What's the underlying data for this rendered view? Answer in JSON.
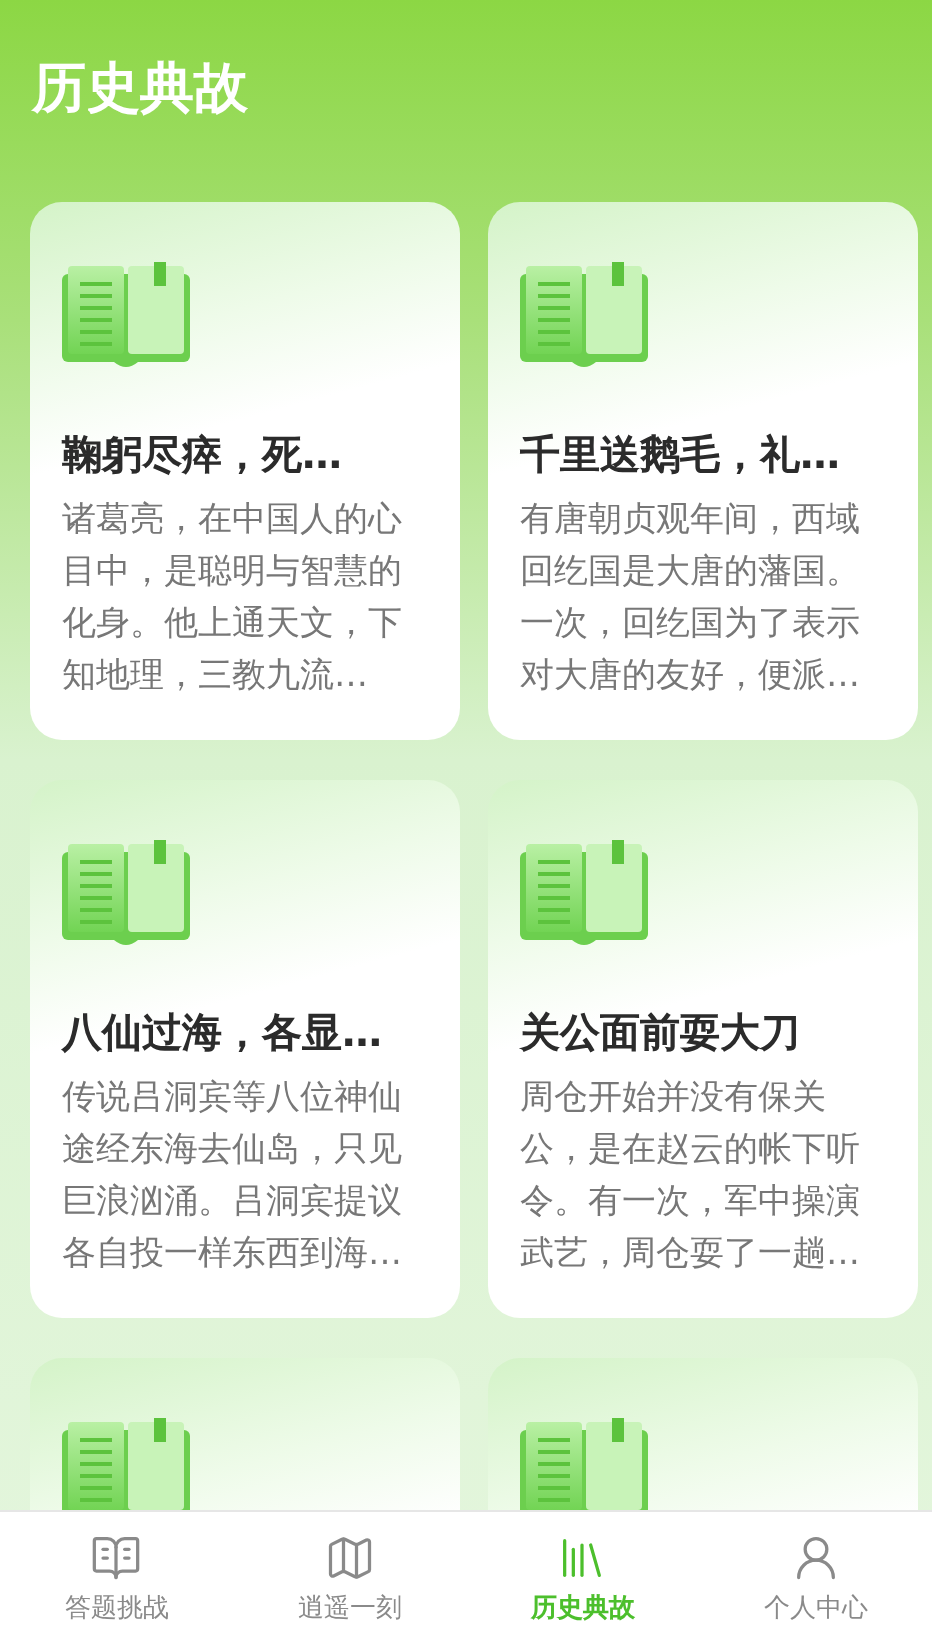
{
  "header": {
    "title": "历史典故"
  },
  "cards": [
    {
      "kind": "story",
      "title": "鞠躬尽瘁，死…",
      "summary": "诸葛亮，在中国人的心目中，是聪明与智慧的化身。他上通天文，下知地理，三教九流…"
    },
    {
      "kind": "story",
      "title": "千里送鹅毛，礼…",
      "summary": "有唐朝贞观年间，西域回纥国是大唐的藩国。一次，回纥国为了表示对大唐的友好，便派…"
    },
    {
      "kind": "story",
      "title": "八仙过海，各显…",
      "summary": "传说吕洞宾等八位神仙途经东海去仙岛，只见巨浪汹涌。吕洞宾提议各自投一样东西到海…"
    },
    {
      "kind": "story",
      "title": "关公面前耍大刀",
      "summary": "周仓开始并没有保关公，是在赵云的帐下听令。有一次，军中操演武艺，周仓耍了一趟…"
    },
    {
      "kind": "partial"
    },
    {
      "kind": "partial"
    }
  ],
  "tabs": [
    {
      "kind": "quiz",
      "label": "答题挑战",
      "selected": false
    },
    {
      "kind": "map",
      "label": "逍遥一刻",
      "selected": false
    },
    {
      "kind": "books",
      "label": "历史典故",
      "selected": true
    },
    {
      "kind": "person",
      "label": "个人中心",
      "selected": false
    }
  ]
}
